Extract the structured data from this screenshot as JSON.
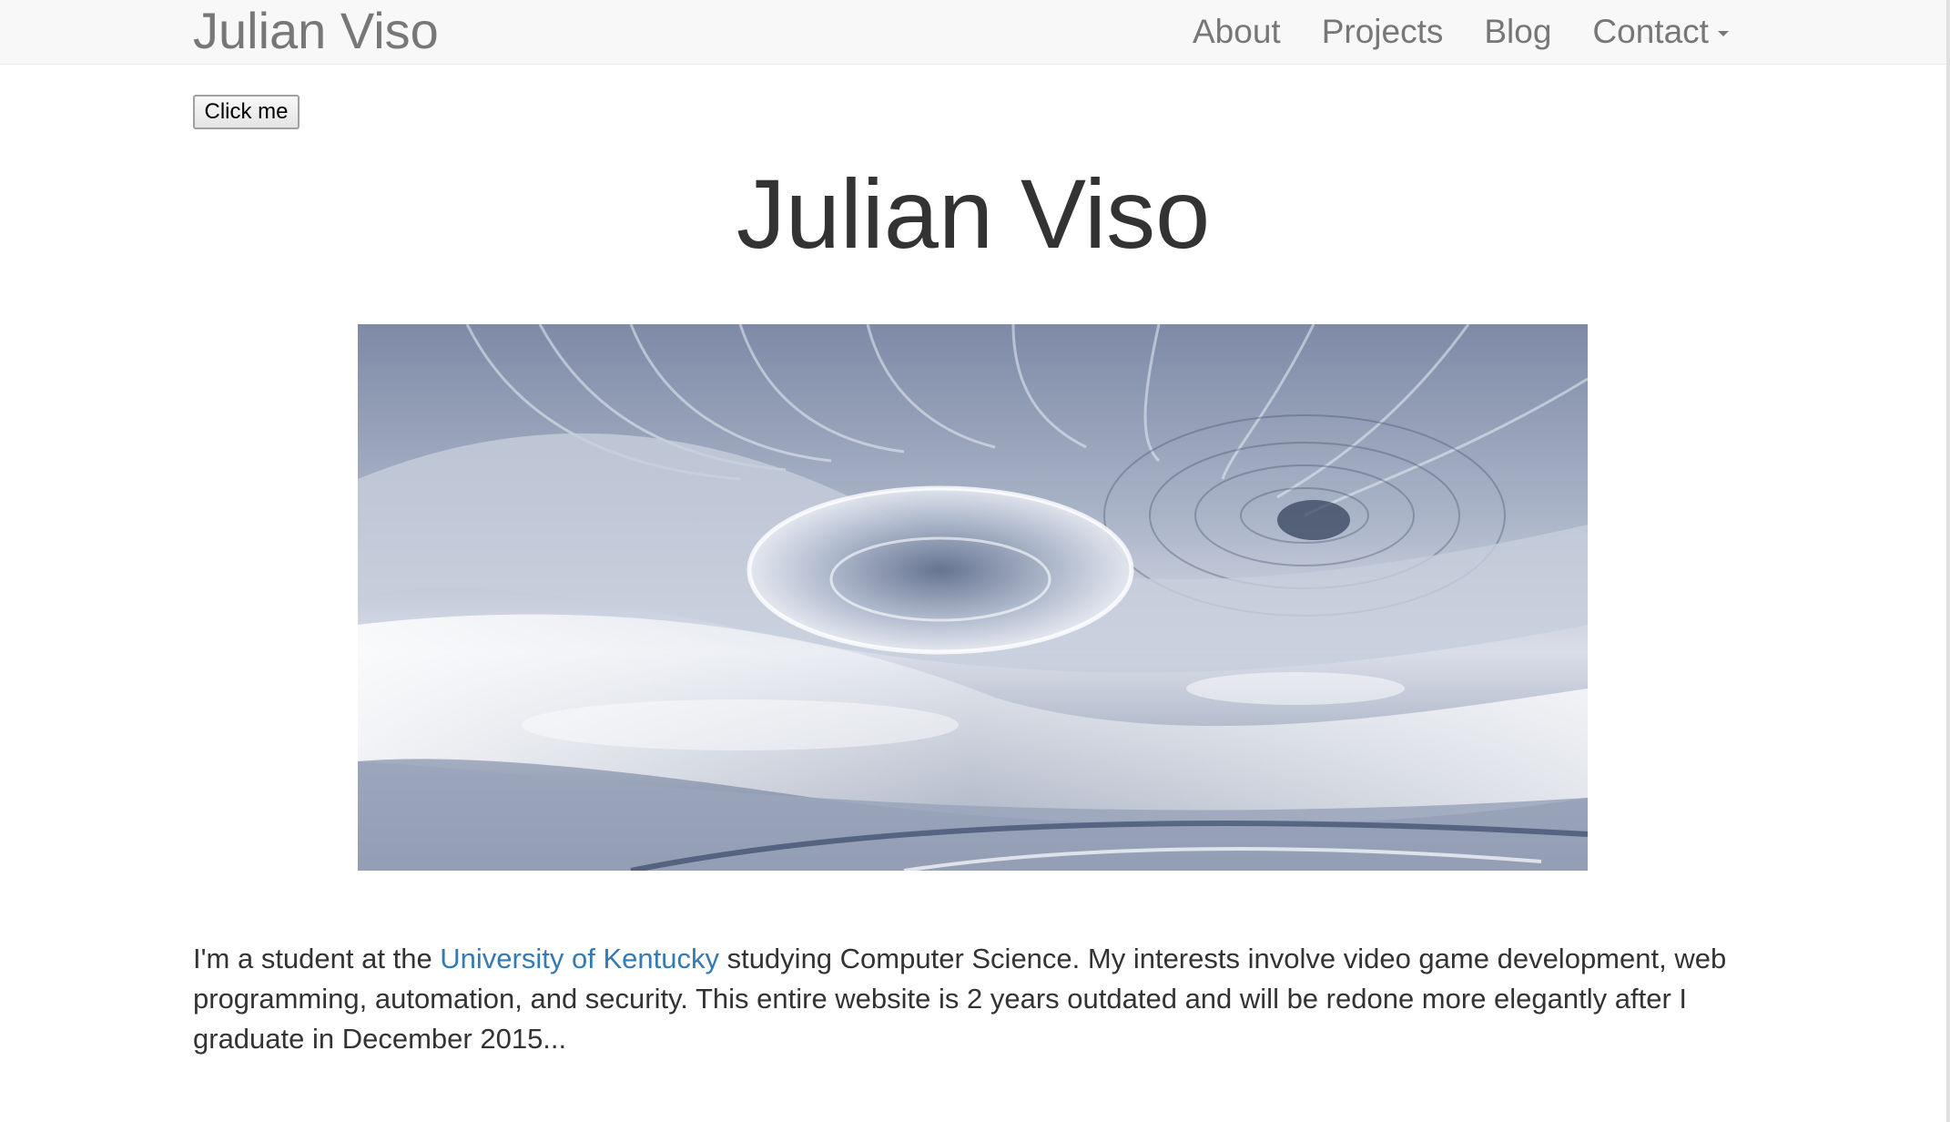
{
  "navbar": {
    "brand": "Julian Viso",
    "links": [
      {
        "label": "About"
      },
      {
        "label": "Projects"
      },
      {
        "label": "Blog"
      },
      {
        "label": "Contact",
        "icon": "caret-down-icon"
      }
    ]
  },
  "button": {
    "label": "Click me"
  },
  "main": {
    "title": "Julian Viso",
    "hero_image": {
      "icon": "abstract-swirl-image"
    },
    "bio": {
      "before": "I'm a student at the ",
      "link": "University of Kentucky",
      "after": " studying Computer Science. My interests involve video game development, web programming, automation, and security. This entire website is 2 years outdated and will be redone more elegantly after I graduate in December 2015..."
    }
  },
  "colors": {
    "navbar_bg": "#f8f8f8",
    "nav_text": "#777777",
    "text": "#333333",
    "link": "#337ab7"
  }
}
